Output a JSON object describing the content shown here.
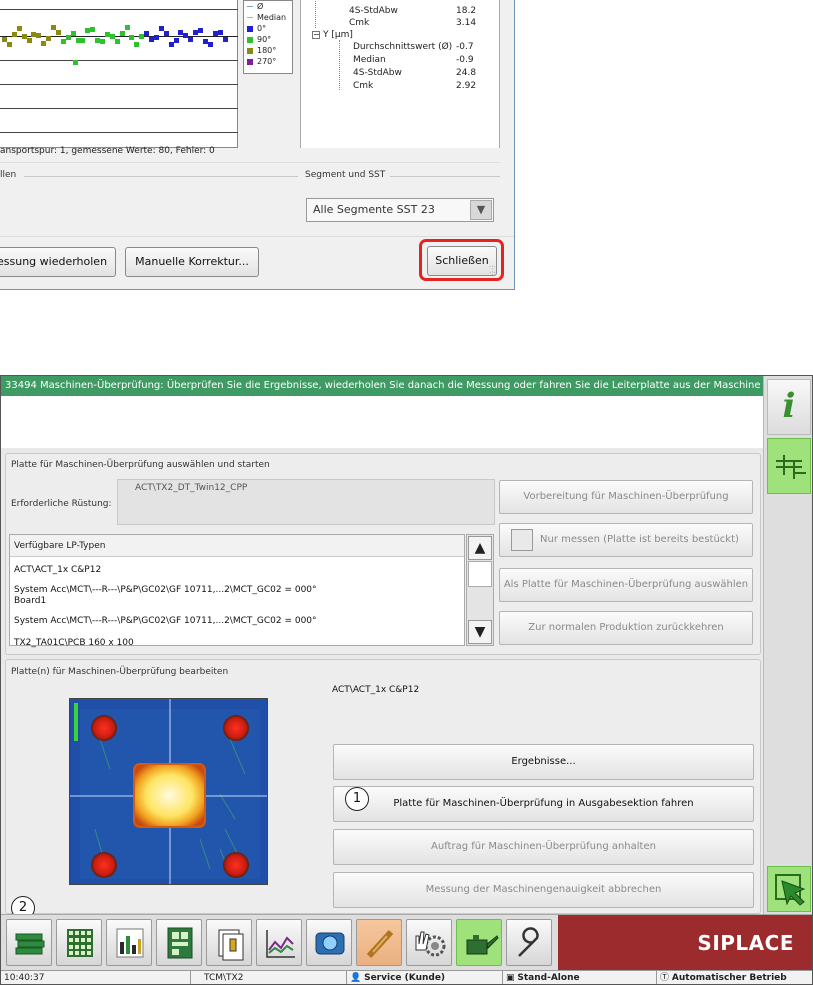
{
  "dialog": {
    "legend": [
      "Ø",
      "Median",
      "0°",
      "90°",
      "180°",
      "270°"
    ],
    "legend_colors": [
      "#7f9fd0",
      "#b0b0b0",
      "#2020d0",
      "#2ec32e",
      "#8a8a10",
      "#7f1f9f"
    ],
    "tree": {
      "x_rows": [
        {
          "label": "4S-StdAbw",
          "value": "18.2"
        },
        {
          "label": "Cmk",
          "value": "3.14"
        }
      ],
      "y_header": "Y [µm]",
      "y_rows": [
        {
          "label": "Durchschnittswert (Ø)",
          "value": "-0.7"
        },
        {
          "label": "Median",
          "value": "-0.9"
        },
        {
          "label": "4S-StdAbw",
          "value": "24.8"
        },
        {
          "label": "Cmk",
          "value": "2.92"
        }
      ]
    },
    "status_text": "ansportspur: 1, gemessene Werte: 80, Fehler: 0",
    "group_left_label": "llen",
    "group_right_label": "Segment und SST",
    "segment_select_value": "Alle Segmente SST 23",
    "btn_repeat": "essung wiederholen",
    "btn_manual": "Manuelle Korrektur...",
    "btn_close": "Schließen"
  },
  "app": {
    "message": "33494 Maschinen-Überprüfung: Überprüfen Sie die Ergebnisse, wiederholen Sie danach die Messung oder fahren Sie die Leiterplatte aus der Maschine",
    "select_panel": {
      "title": "Platte für Maschinen-Überprüfung auswählen und starten",
      "setup_label": "Erforderliche Rüstung:",
      "setup_value": "ACT\\TX2_DT_Twin12_CPP",
      "list_header": "Verfügbare LP-Typen",
      "list_items": [
        "ACT\\ACT_1x C&P12",
        "System Acc\\MCT\\---R---\\P&P\\GC02\\GF 10711,...2\\MCT_GC02 = 000°",
        "Board1",
        "System Acc\\MCT\\---R---\\P&P\\GC02\\GF 10711,...2\\MCT_GC02 = 000°",
        "TX2_TA01C\\PCB 160 x 100"
      ],
      "btn_prepare": "Vorbereitung für Maschinen-Überprüfung",
      "chk_measure_only": "Nur messen (Platte ist bereits bestückt)",
      "btn_select_board": "Als Platte für Maschinen-Überprüfung auswählen",
      "btn_back_production": "Zur normalen Produktion zurückkehren"
    },
    "edit_panel": {
      "title": "Platte(n) für Maschinen-Überprüfung bearbeiten",
      "board_name": "ACT\\ACT_1x C&P12",
      "btn_results": "Ergebnisse...",
      "btn_move_out": "Platte für Maschinen-Überprüfung in Ausgabesektion fahren",
      "btn_stop_job": "Auftrag für Maschinen-Überprüfung anhalten",
      "btn_abort": "Messung der Maschinengenauigkeit abbrechen"
    },
    "callouts": [
      "1",
      "2"
    ],
    "info_icon": "i",
    "brand": "SIPLACE",
    "status": {
      "time": "10:40:37",
      "line": "TCM\\TX2",
      "user": "Service (Kunde)",
      "mode": "Stand-Alone",
      "operation": "Automatischer Betrieb"
    }
  }
}
